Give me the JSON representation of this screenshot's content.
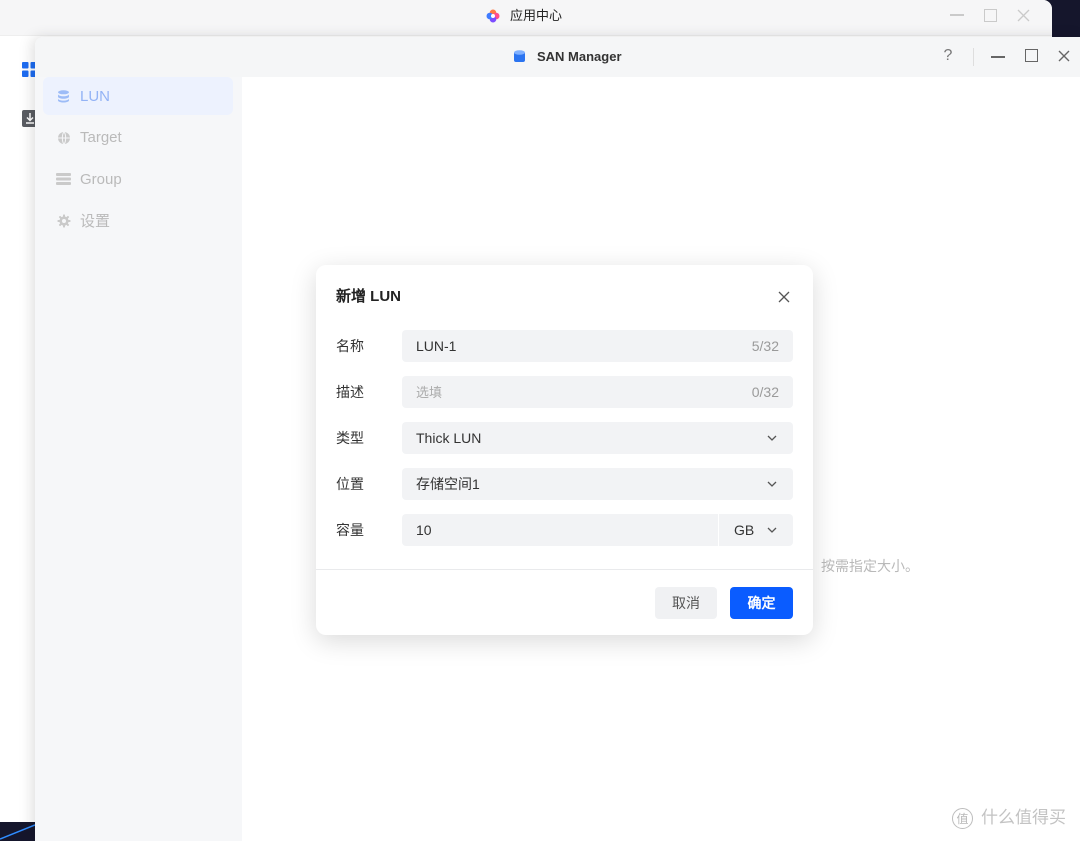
{
  "background_window": {
    "title": "应用中心",
    "icon": "app-center-icon",
    "sidebar_icons": [
      "grid-icon",
      "download-icon"
    ]
  },
  "window": {
    "title": "SAN Manager",
    "icon": "san-manager-icon",
    "help_label": "?"
  },
  "sidebar": {
    "items": [
      {
        "label": "LUN",
        "icon": "database-icon",
        "selected": true
      },
      {
        "label": "Target",
        "icon": "globe-icon",
        "selected": false
      },
      {
        "label": "Group",
        "icon": "server-list-icon",
        "selected": false
      },
      {
        "label": "设置",
        "icon": "gear-icon",
        "selected": false
      }
    ]
  },
  "main": {
    "background_text": "按需指定大小。"
  },
  "dialog": {
    "title": "新增 LUN",
    "fields": {
      "name": {
        "label": "名称",
        "value": "LUN-1",
        "counter": "5/32"
      },
      "description": {
        "label": "描述",
        "placeholder": "选填",
        "counter": "0/32"
      },
      "type": {
        "label": "类型",
        "value": "Thick LUN"
      },
      "location": {
        "label": "位置",
        "value": "存储空间1"
      },
      "capacity": {
        "label": "容量",
        "value": "10",
        "unit": "GB"
      }
    },
    "cancel_label": "取消",
    "confirm_label": "确定"
  },
  "watermark": {
    "badge": "值",
    "text": "什么值得买"
  },
  "colors": {
    "accent": "#0a5cff",
    "desktop": "#15162c",
    "sidebar_selected_bg": "#edf2fe",
    "field_bg": "#f2f3f5"
  }
}
